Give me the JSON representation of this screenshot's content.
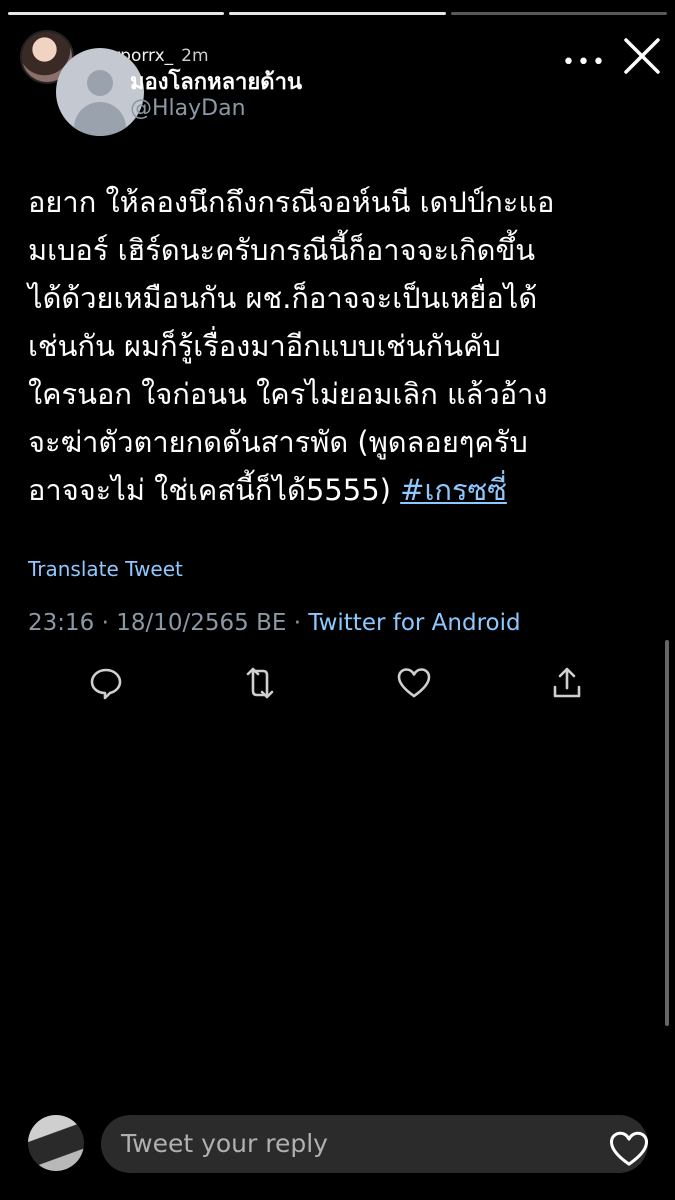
{
  "story": {
    "username": "norporrx_",
    "time": "2m",
    "more_icon": "more-dots-icon",
    "close_icon": "close-icon"
  },
  "tweet": {
    "display_name": "มองโลกหลายด้าน",
    "handle": "@HlayDan",
    "text_lines": [
      "อยาก ให้ลองนึกถึงกรณีจอห์นนี เดปป์กะแอ",
      "มเบอร์ เฮิร์ดนะครับกรณีนี้ก็อาจจะเกิดขึ้น",
      "ได้ด้วยเหมือนกัน ผช.ก็อาจจะเป็นเหยื่อได้",
      "เช่นกัน ผมก็รู้เรื่องมาอีกแบบเช่นกันคับ",
      " ใครนอก ใจก่อนน ใครไม่ยอมเลิก แล้วอ้าง",
      "จะฆ่าตัวตายกดดันสารพัด (พูดลอยๆครับ",
      "อาจจะไม่ ใช่เคสนี้ก็ได้5555) "
    ],
    "hashtag": "#เกรซซี่",
    "translate_label": "Translate Tweet",
    "timestamp": "23:16 · 18/10/2565 BE · ",
    "source": "Twitter for Android",
    "actions": [
      "reply-icon",
      "retweet-icon",
      "like-icon",
      "share-icon"
    ]
  },
  "reply": {
    "placeholder": "Tweet your reply"
  },
  "colors": {
    "background": "#000000",
    "link": "#8ec8ff",
    "muted": "#8b98a5"
  }
}
